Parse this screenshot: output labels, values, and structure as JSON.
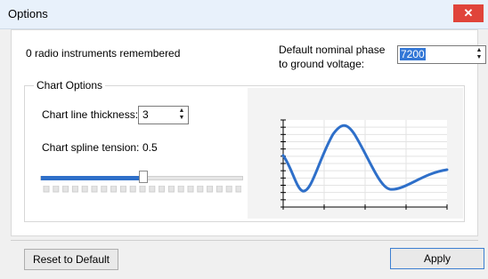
{
  "window": {
    "title": "Options",
    "close_symbol": "✕"
  },
  "radio_count_text": "0 radio instruments remembered",
  "phase": {
    "label": "Default nominal phase to ground voltage:",
    "value": "7200"
  },
  "chart_options": {
    "legend": "Chart Options",
    "thickness_label": "Chart line thickness:",
    "thickness_value": "3",
    "tension_label": "Chart spline tension:",
    "tension_value": "0.5",
    "slider_level": 0.5
  },
  "preview_chart": {
    "curve_color": "#2e6fc9",
    "grid": true
  },
  "buttons": {
    "reset": "Reset to Default",
    "apply": "Apply"
  },
  "colors": {
    "accent": "#2e6fc9",
    "close": "#e0443a"
  }
}
